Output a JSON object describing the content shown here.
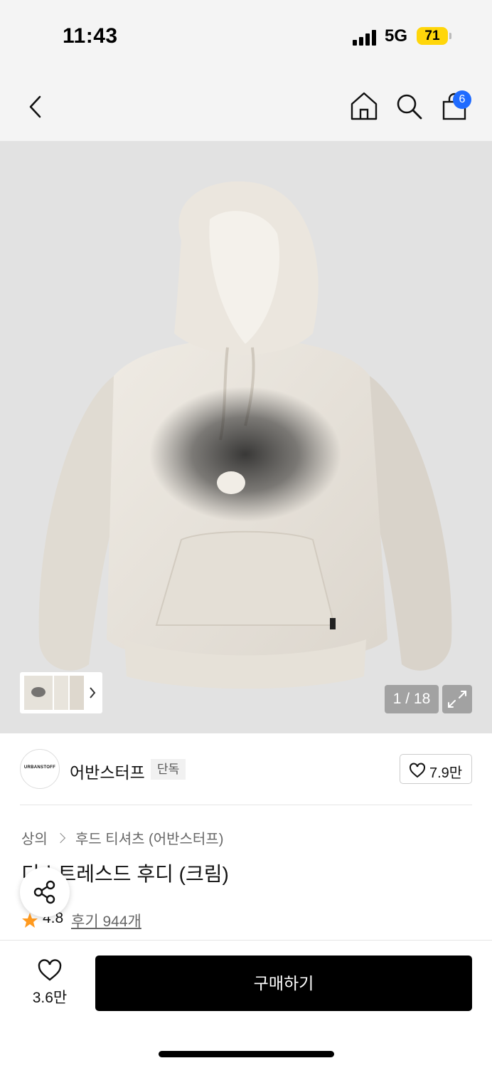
{
  "status_bar": {
    "time": "11:43",
    "network": "5G",
    "battery": "71"
  },
  "nav": {
    "cart_count": "6",
    "icons": [
      "back-icon",
      "home-icon",
      "search-icon",
      "shopping-bag-icon"
    ]
  },
  "gallery": {
    "counter": "1 / 18"
  },
  "brand": {
    "logo_text": "URBANSTOFF",
    "name": "어반스터프",
    "tag": "단독",
    "likes": "7.9만"
  },
  "breadcrumb": [
    "상의",
    "후드 티셔츠 (어반스터프)"
  ],
  "product": {
    "title": "디스트레스드 후디 (크림)",
    "rating": "4.8",
    "reviews": "후기 944개"
  },
  "bottom_bar": {
    "wish_count": "3.6만",
    "buy_label": "구매하기"
  },
  "colors": {
    "accent": "#1f6bff",
    "star": "#ff9a1f",
    "buy_button": "#000000",
    "battery": "#ffd60a"
  }
}
